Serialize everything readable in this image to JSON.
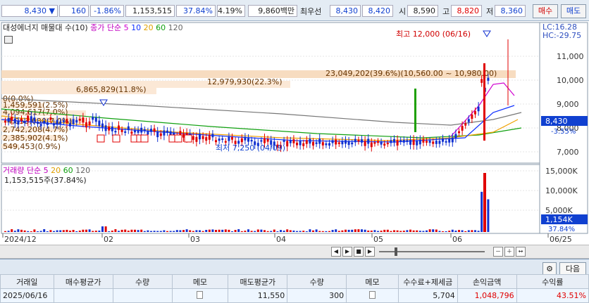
{
  "quote": {
    "price": "8,430",
    "change": "160",
    "change_pct": "-1.86%",
    "volume": "1,153,515",
    "turnover_pct": "37.84%",
    "ratio": "4.19%",
    "amount": "9,860백만",
    "best_label": "최우선",
    "best_ask": "8,430",
    "best_bid": "8,420",
    "open_label": "시",
    "open": "8,590",
    "high_label": "고",
    "high": "8,820",
    "low_label": "저",
    "low": "8,360",
    "buy_label": "매수",
    "sell_label": "매도"
  },
  "chart": {
    "title": "대성에너지 매물대 수(10)",
    "ma_label": "종가 단순",
    "ma_periods": [
      "5",
      "10",
      "20",
      "60",
      "120"
    ],
    "ma_colors": [
      "#d000d0",
      "#1030ff",
      "#f0a000",
      "#10a010",
      "#666666"
    ],
    "lc": "LC:16.28",
    "hc": "HC:-29.75",
    "price_ticks": [
      "11,000",
      "10,000",
      "9,000",
      "8,000",
      "7,000"
    ],
    "current_price": "8,430",
    "current_pct": "-3.55%",
    "high_note": "최고 12,000 (06/16)",
    "low_note": "최저 7,250 (04/09)",
    "volume_profile": [
      "23,049,202(39.6%)(10,560.00 ~ 10,980.00)",
      "12,979,930(22.3%)",
      "6,865,829(11.8%)",
      "0(0.0%)",
      "1,459,591(2.5%)",
      "4,094,617(7.0%)",
      "4,053,030(7.0%)",
      "2,742,208(4.7%)",
      "2,385,902(4.1%)",
      "549,453(0.9%)"
    ],
    "vol_label": "거래량",
    "vol_ma_label": "단순",
    "vol_periods": [
      "5",
      "20",
      "60",
      "120"
    ],
    "vol_value": "1,153,515주(37.84%)",
    "vol_ticks": [
      "15,000K",
      "10,000K",
      "5,000K"
    ],
    "vol_current": "1,154K",
    "vol_pct": "37.84%",
    "date_labels": [
      "2024/12",
      "02",
      "03",
      "04",
      "05",
      "06",
      "06/25"
    ]
  },
  "panel": {
    "next_label": "다음",
    "headers": [
      "거래일",
      "매수평균가",
      "수량",
      "메모",
      "매도평균가",
      "수량",
      "메모",
      "수수료+제세금",
      "손익금액",
      "수익률"
    ],
    "row": [
      "2025/06/16",
      "",
      "",
      "",
      "11,550",
      "300",
      "",
      "5,704",
      "1,048,796",
      "43.51%"
    ]
  }
}
